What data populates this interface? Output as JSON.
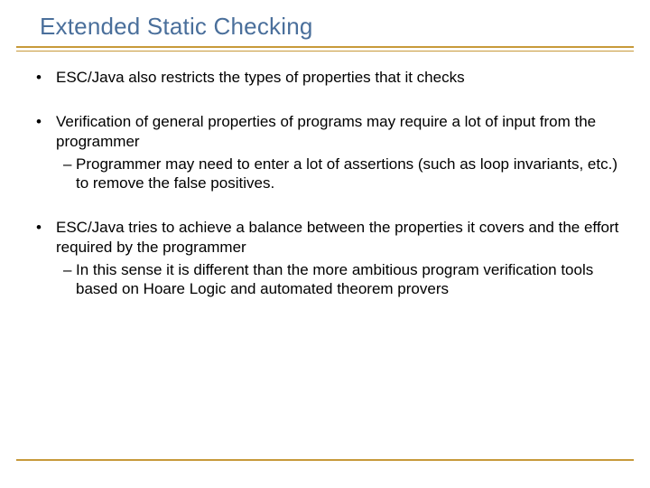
{
  "title": "Extended Static Checking",
  "bullets": [
    {
      "text": "ESC/Java also restricts the types of properties that it checks",
      "sub": []
    },
    {
      "text": "Verification of general properties of programs may require a lot of input from the programmer",
      "sub": [
        "Programmer may need to enter a lot of assertions (such as loop invariants, etc.) to remove the false positives."
      ]
    },
    {
      "text": "ESC/Java tries to achieve a balance between the properties it covers and the effort required by the programmer",
      "sub": [
        "In this sense it is different than the more ambitious program verification tools based on Hoare Logic and automated theorem provers"
      ]
    }
  ]
}
